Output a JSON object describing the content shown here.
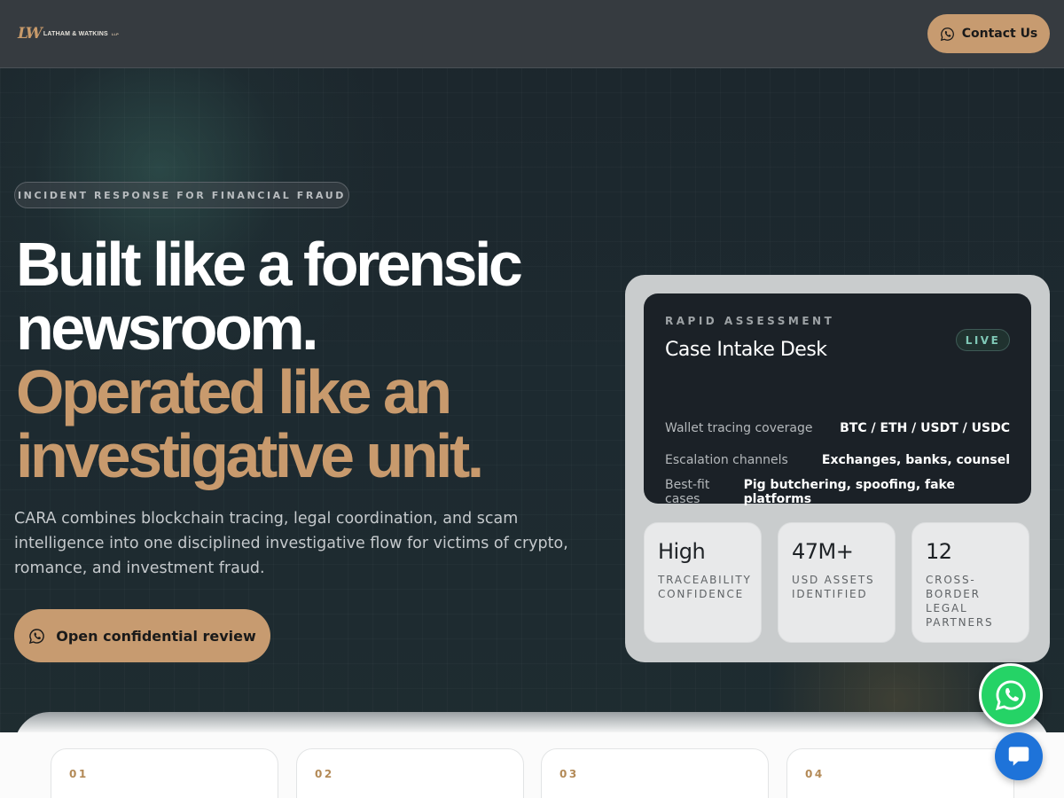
{
  "header": {
    "logo_mark": "LW",
    "logo_text": "LATHAM & WATKINS",
    "logo_suffix": "LLP",
    "contact_label": "Contact Us"
  },
  "hero": {
    "eyebrow": "INCIDENT RESPONSE FOR FINANCIAL FRAUD",
    "headline_line1": "Built like a forensic",
    "headline_line2": "newsroom.",
    "headline_line3": "Operated like an",
    "headline_line4": "investigative unit.",
    "lead": "CARA combines blockchain tracing, legal coordination, and scam intelligence into one disciplined investigative flow for victims of crypto, romance, and investment fraud.",
    "cta_label": "Open confidential review"
  },
  "card": {
    "eyebrow": "RAPID ASSESSMENT",
    "title": "Case Intake Desk",
    "badge": "LIVE",
    "rows": [
      {
        "key": "Wallet tracing coverage",
        "value": "BTC / ETH / USDT / USDC"
      },
      {
        "key": "Escalation channels",
        "value": "Exchanges, banks, counsel"
      },
      {
        "key": "Best-fit cases",
        "value": "Pig butchering, spoofing, fake platforms"
      }
    ],
    "stats": [
      {
        "value": "High",
        "label": "TRACEABILITY CONFIDENCE"
      },
      {
        "value": "47M+",
        "label": "USD ASSETS IDENTIFIED"
      },
      {
        "value": "12",
        "label": "CROSS-BORDER LEGAL PARTNERS"
      }
    ]
  },
  "steps": [
    "01",
    "02",
    "03",
    "04"
  ],
  "colors": {
    "accent": "#c79b70",
    "headline_accent": "#c89a6d",
    "live": "#7fc8b6",
    "whatsapp": "#25d366",
    "chat": "#1e73d9"
  },
  "icons": {
    "contact": "whatsapp-icon",
    "cta": "whatsapp-icon",
    "float_whatsapp": "whatsapp-icon",
    "float_chat": "chat-bubble-icon"
  }
}
